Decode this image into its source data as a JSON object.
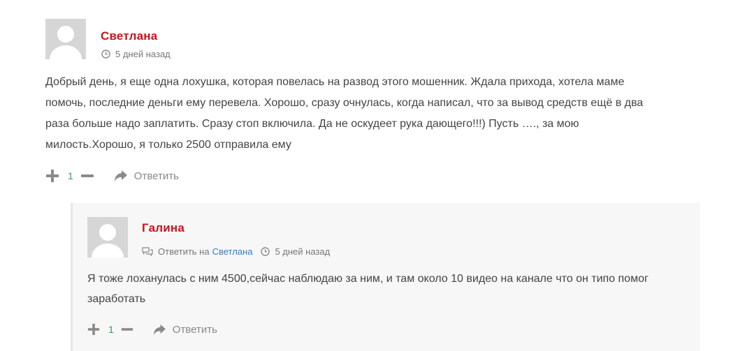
{
  "comments": [
    {
      "author": "Светлана",
      "time": "5 дней назад",
      "text_lines": [
        "Добрый день, я еще одна лохушка, которая повелась на развод этого мошенник. Ждала прихода, хотела маме",
        "помочь, последние деньги ему перевела. Хорошо, сразу очнулась, когда написал, что за вывод средств ещё в два",
        "раза больше надо заплатить. Сразу стоп включила. Да не оскудеет рука дающего!!!) Пусть …., за мою",
        "милость.Хорошо, я только 2500 отправила ему"
      ],
      "votes": "1",
      "reply_label": "Ответить"
    },
    {
      "author": "Галина",
      "reply_to_label": "Ответить на",
      "reply_to_author": "Светлана",
      "time": "5 дней назад",
      "text_lines": [
        "Я тоже лоханулась с ним 4500,сейчас наблюдаю за ним, и там около 10 видео на канале что он типо помог",
        "заработать"
      ],
      "votes": "1",
      "reply_label": "Ответить"
    }
  ],
  "icons": {
    "avatar": "default-avatar-icon",
    "time": "clock-icon",
    "reply_to": "comments-icon",
    "upvote": "plus-icon",
    "downvote": "minus-icon",
    "reply": "share-arrow-icon"
  },
  "colors": {
    "author": "#c4161c",
    "vote_count": "#2e9e4f",
    "link": "#3a7bbf",
    "reply_background": "#f7f7f7"
  }
}
